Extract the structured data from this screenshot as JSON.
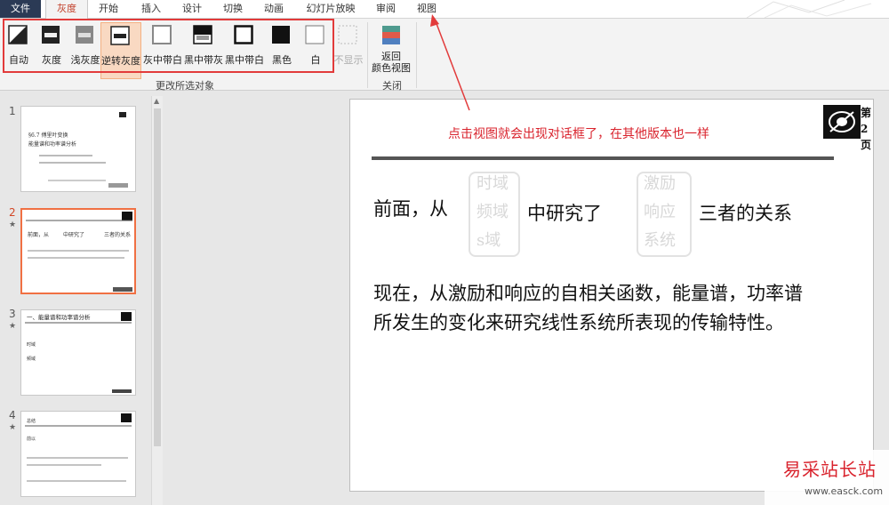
{
  "tabs": [
    {
      "label": "文件",
      "state": "file"
    },
    {
      "label": "灰度",
      "state": "active"
    },
    {
      "label": "开始"
    },
    {
      "label": "插入"
    },
    {
      "label": "设计"
    },
    {
      "label": "切换"
    },
    {
      "label": "动画"
    },
    {
      "label": "幻灯片放映"
    },
    {
      "label": "审阅"
    },
    {
      "label": "视图"
    }
  ],
  "ribbon": {
    "buttons": [
      {
        "label": "自动",
        "icon": "auto-grayscale-icon"
      },
      {
        "label": "灰度",
        "icon": "grayscale-icon"
      },
      {
        "label": "浅灰度",
        "icon": "light-grayscale-icon"
      },
      {
        "label": "逆转灰度",
        "icon": "inverse-grayscale-icon",
        "selected": true
      },
      {
        "label": "灰中带白",
        "icon": "gray-with-white-icon"
      },
      {
        "label": "黑中带灰",
        "icon": "black-with-gray-icon"
      },
      {
        "label": "黑中带白",
        "icon": "black-with-white-icon"
      },
      {
        "label": "黑色",
        "icon": "black-icon"
      },
      {
        "label": "白",
        "icon": "white-icon"
      },
      {
        "label": "不显示",
        "icon": "dont-show-icon",
        "disabled": true
      }
    ],
    "group_label": "更改所选对象",
    "close_button": {
      "line1": "返回",
      "line2": "颜色视图",
      "icon": "back-to-color-view-icon"
    },
    "close_group_label": "关闭"
  },
  "thumbnails": [
    {
      "number": "1",
      "star": "",
      "lines": [
        "§6.7 傅里叶...",
        "...",
        "能量谱和功率谱分析"
      ]
    },
    {
      "number": "2",
      "star": "★",
      "selected": true,
      "lines": [
        "前面，从",
        "中研究了",
        "三者的关系",
        "现在，从激励和响应的自相关函数..."
      ]
    },
    {
      "number": "3",
      "star": "★",
      "lines": [
        "一、能量谱和功率谱分析",
        "时域",
        "频域"
      ]
    },
    {
      "number": "4",
      "star": "★",
      "lines": [
        "总结",
        "前以",
        "响应是..."
      ]
    }
  ],
  "slide": {
    "annotation": "点击视图就会出现对话框了，在其他版本也一样",
    "page_tag": [
      "第",
      "2",
      "页"
    ],
    "line1_prefix": "前面，从",
    "line1_middle": "中研究了",
    "line1_suffix": "三者的关系",
    "ghost_left": [
      "时域",
      "频域",
      "s域"
    ],
    "ghost_right": [
      "激励",
      "响应",
      "系统"
    ],
    "para_line1": "现在，从激励和响应的自相关函数，能量谱，功率谱",
    "para_line2": "所发生的变化来研究线性系统所表现的传输特性。"
  },
  "watermark": {
    "title": "易采站长站",
    "url": "www.easck.com"
  },
  "colors": {
    "accent": "#d24726",
    "annotation": "#d9232d",
    "highlight": "#e23b3b"
  }
}
